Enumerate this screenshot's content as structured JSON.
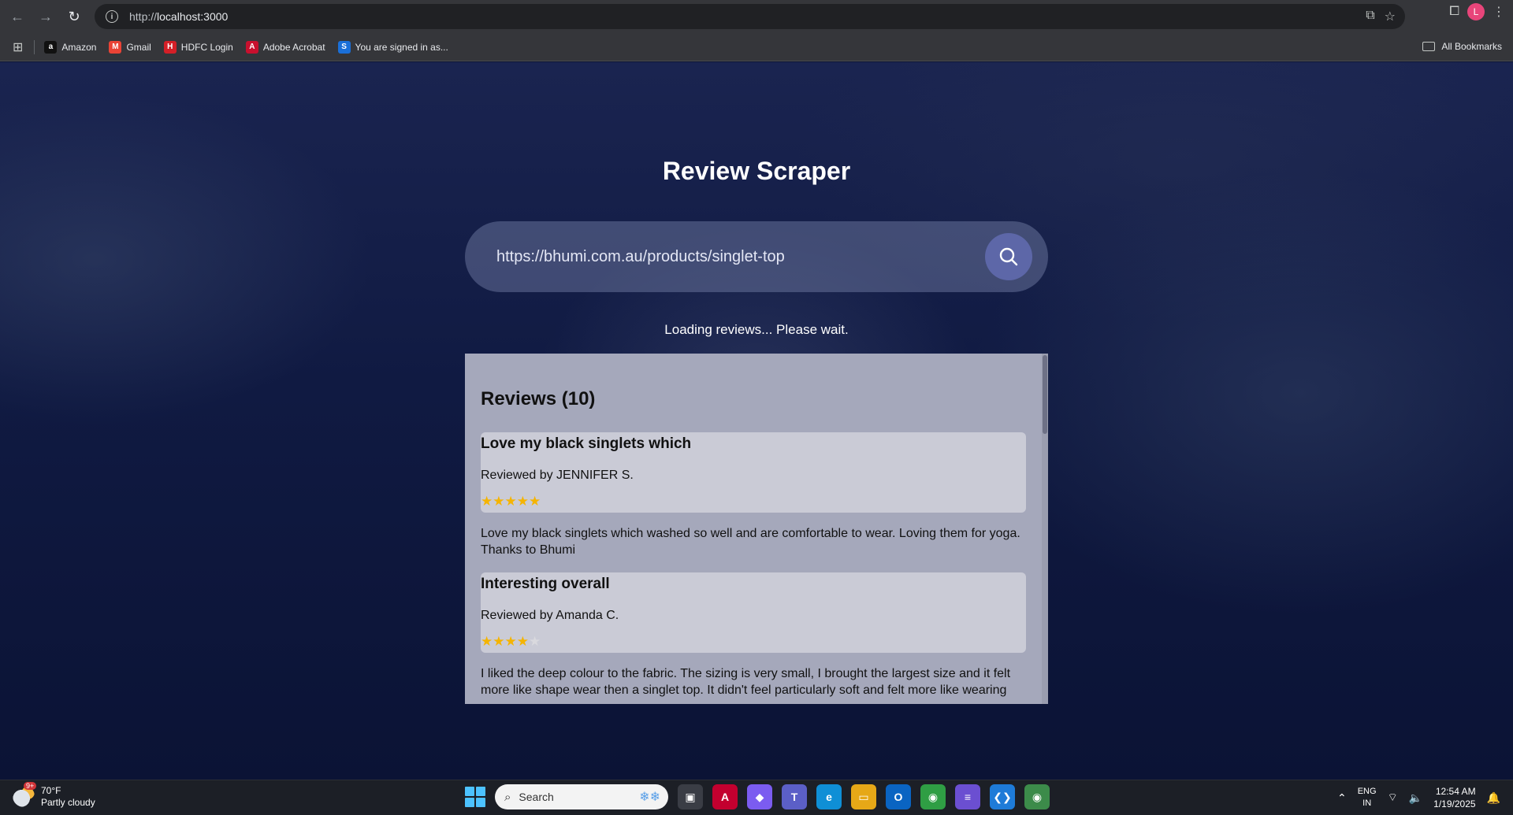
{
  "browser": {
    "url_prefix": "http://",
    "url_host": "localhost:3000",
    "bookmarks": [
      {
        "label": "Amazon",
        "icon": "amazon-icon",
        "color": "#111111",
        "glyph": "a"
      },
      {
        "label": "Gmail",
        "icon": "gmail-icon",
        "color": "#ea4335",
        "glyph": "M"
      },
      {
        "label": "HDFC Login",
        "icon": "hdfc-icon",
        "color": "#d41f27",
        "glyph": "H"
      },
      {
        "label": "Adobe Acrobat",
        "icon": "acrobat-icon",
        "color": "#c8102e",
        "glyph": "A"
      },
      {
        "label": "You are signed in as...",
        "icon": "s-icon",
        "color": "#1a6fd8",
        "glyph": "S"
      }
    ],
    "all_bookmarks": "All Bookmarks",
    "avatar_letter": "L"
  },
  "app": {
    "title": "Review Scraper",
    "search_value": "https://bhumi.com.au/products/singlet-top",
    "status": "Loading reviews... Please wait.",
    "reviews_heading": "Reviews (10)"
  },
  "reviews": [
    {
      "title": "Love my black singlets which",
      "author": "Reviewed by JENNIFER S.",
      "rating": 5,
      "body": "Love my black singlets which washed so well and are comfortable to wear. Loving them for yoga. Thanks to Bhumi"
    },
    {
      "title": "Interesting overall",
      "author": "Reviewed by Amanda C.",
      "rating": 4,
      "body": "I liked the deep colour to the fabric. The sizing is very small, I brought the largest size and it felt more like shape wear then a singlet top. It didn't feel particularly soft and felt more like wearing"
    }
  ],
  "taskbar": {
    "temp": "70°F",
    "weather": "Partly cloudy",
    "weather_badge": "9+",
    "search_label": "Search",
    "lang_top": "ENG",
    "lang_bottom": "IN",
    "time": "12:54 AM",
    "date": "1/19/2025",
    "apps": [
      {
        "name": "task-view-icon",
        "color": "#3a3d45",
        "glyph": "▣"
      },
      {
        "name": "angular-icon",
        "color": "#c3002f",
        "glyph": "A"
      },
      {
        "name": "copilot-icon",
        "color": "#7b5cf0",
        "glyph": "◆"
      },
      {
        "name": "teams-icon",
        "color": "#5b5fc7",
        "glyph": "T"
      },
      {
        "name": "edge-icon",
        "color": "#0f8fd6",
        "glyph": "e"
      },
      {
        "name": "file-explorer-icon",
        "color": "#e6a817",
        "glyph": "▭"
      },
      {
        "name": "outlook-icon",
        "color": "#0a64c2",
        "glyph": "O"
      },
      {
        "name": "chrome-icon",
        "color": "#2f9e44",
        "glyph": "◉"
      },
      {
        "name": "notes-icon",
        "color": "#6b4fd1",
        "glyph": "≡"
      },
      {
        "name": "vscode-icon",
        "color": "#1e7bd8",
        "glyph": "❮❯"
      },
      {
        "name": "chrome-profile-icon",
        "color": "#3c8b4a",
        "glyph": "◉"
      }
    ]
  }
}
